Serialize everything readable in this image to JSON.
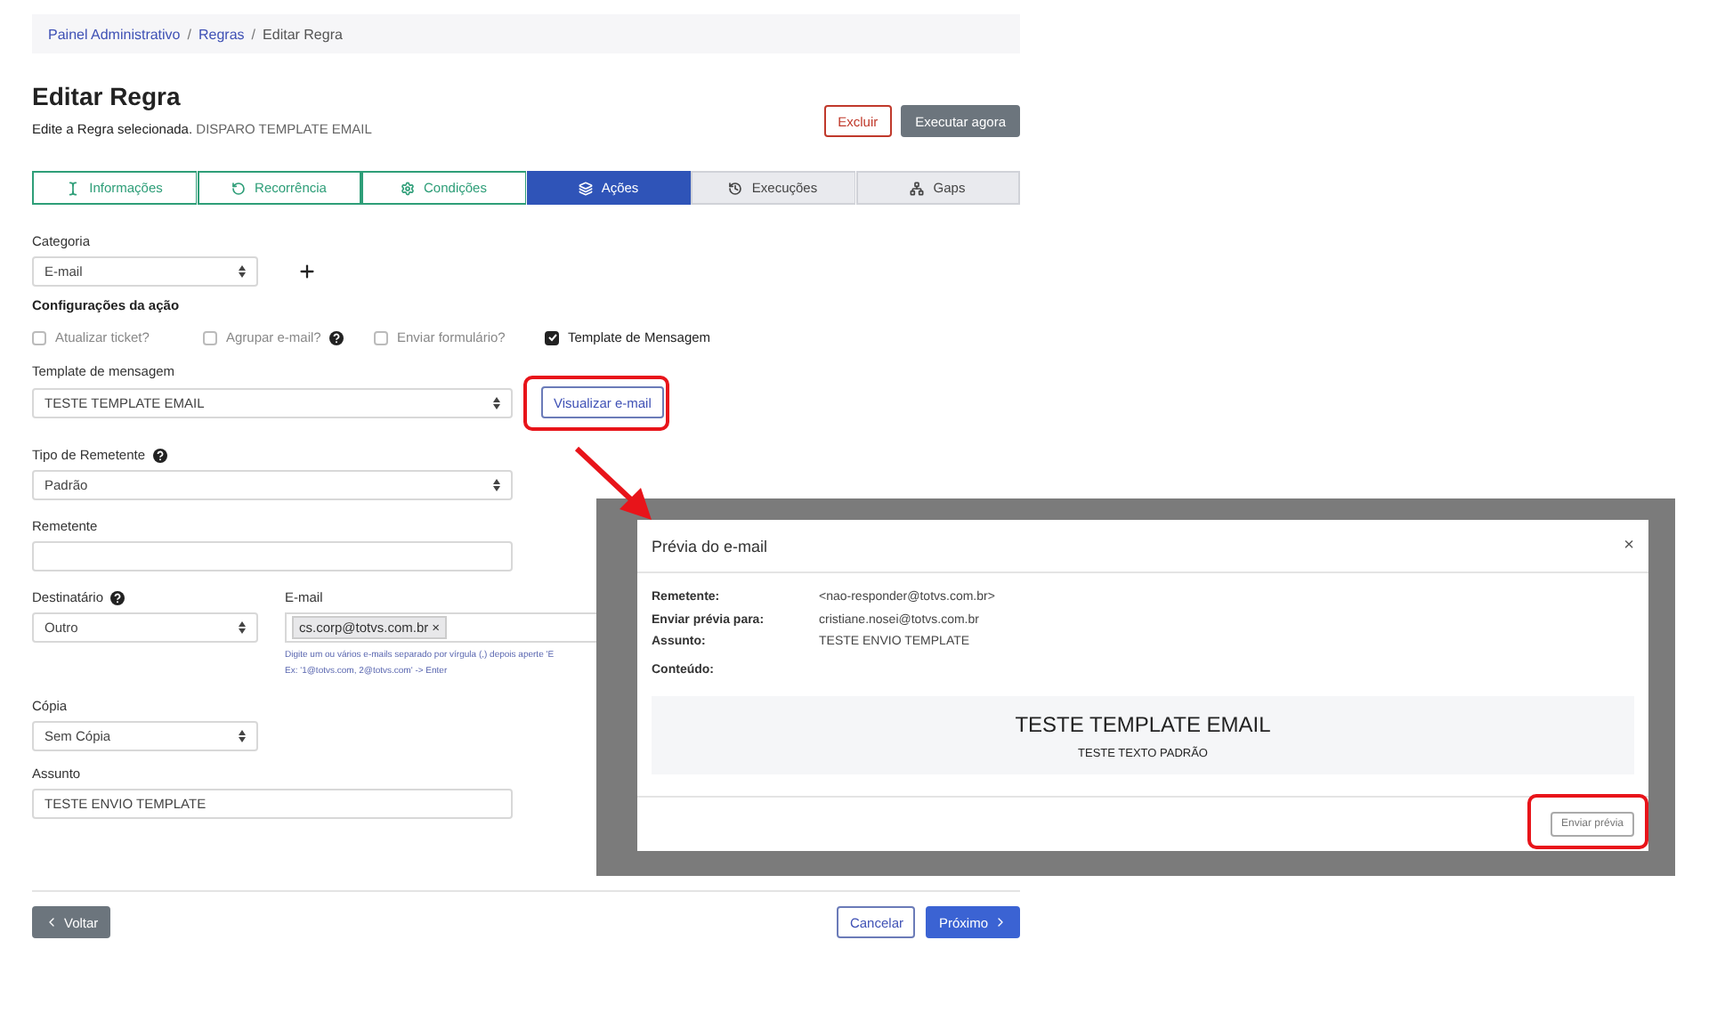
{
  "breadcrumb": [
    {
      "label": "Painel Administrativo",
      "link": true
    },
    {
      "label": "Regras",
      "link": true
    },
    {
      "label": "Editar Regra",
      "link": false
    }
  ],
  "breadcrumb_separator": "/",
  "page": {
    "title": "Editar Regra",
    "subtitle": "Edite a Regra selecionada.",
    "rule_name": "DISPARO TEMPLATE EMAIL"
  },
  "header_buttons": [
    {
      "label": "Excluir",
      "kind": "danger"
    },
    {
      "label": "Executar agora",
      "kind": "secondary"
    }
  ],
  "steps": [
    {
      "label": "Informações",
      "done": true,
      "selected": false
    },
    {
      "label": "Recorrência",
      "done": true,
      "selected": false
    },
    {
      "label": "Condições",
      "done": true,
      "selected": false
    },
    {
      "label": "Ações",
      "done": false,
      "selected": true
    },
    {
      "label": "Execuções",
      "done": false,
      "selected": false
    },
    {
      "label": "Gaps",
      "done": false,
      "selected": false
    }
  ],
  "categoria": {
    "label": "Categoria",
    "value": "E-mail"
  },
  "action_settings": {
    "title": "Configurações da ação",
    "options": [
      {
        "label": "Atualizar ticket?",
        "checked": false,
        "help": false
      },
      {
        "label": "Agrupar e-mail?",
        "checked": false,
        "help": true
      },
      {
        "label": "Enviar formulário?",
        "checked": false,
        "help": false
      },
      {
        "label": "Template de Mensagem",
        "checked": true,
        "help": false
      }
    ]
  },
  "template": {
    "label": "Template de mensagem",
    "value": "TESTE TEMPLATE EMAIL",
    "preview_button": "Visualizar e-mail"
  },
  "sender_type": {
    "label": "Tipo de Remetente",
    "help": true,
    "value": "Padrão"
  },
  "sender": {
    "label": "Remetente"
  },
  "recipient": {
    "label": "Destinatário",
    "help": true,
    "value": "Outro"
  },
  "email": {
    "label": "E-mail",
    "tags": [
      {
        "label": "cs.corp@totvs.com.br",
        "remove": "×"
      }
    ],
    "hint": "Digite um ou vários e-mails separado por vírgula (,) depois aperte 'E",
    "example": "Ex: '1@totvs.com, 2@totvs.com' -> Enter"
  },
  "copy": {
    "label": "Cópia",
    "value": "Sem Cópia"
  },
  "subject": {
    "label": "Assunto",
    "value": "TESTE ENVIO TEMPLATE"
  },
  "footer": {
    "back": "Voltar",
    "cancel": "Cancelar",
    "next": "Próximo"
  },
  "modal": {
    "title": "Prévia do e-mail",
    "close": "×",
    "rows": [
      {
        "label": "Remetente:",
        "value": "<nao-responder@totvs.com.br>"
      },
      {
        "label": "Enviar prévia para:",
        "value": "cristiane.nosei@totvs.com.br"
      },
      {
        "label": "Assunto:",
        "value": "TESTE ENVIO TEMPLATE"
      },
      {
        "label": "Conteúdo:",
        "value": ""
      }
    ],
    "content_title": "TESTE TEMPLATE EMAIL",
    "content_text": "TESTE TEXTO PADRÃO",
    "send_button": "Enviar prévia"
  }
}
